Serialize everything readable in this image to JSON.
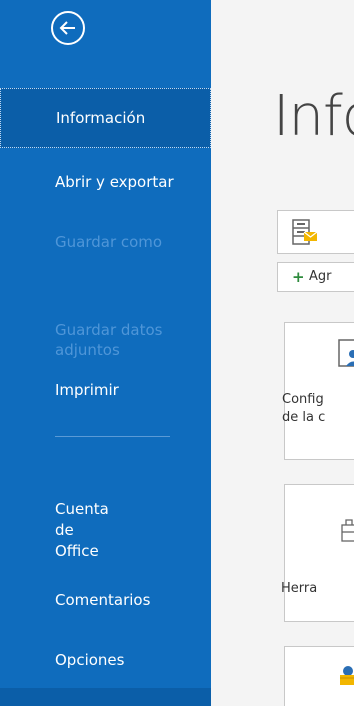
{
  "sidebar": {
    "items": [
      {
        "label": "Información"
      },
      {
        "label": "Abrir y exportar"
      },
      {
        "label": "Guardar como"
      },
      {
        "label": "Guardar datos\nadjuntos"
      },
      {
        "label": "Imprimir"
      },
      {
        "label": "Cuenta\nde\nOffice"
      },
      {
        "label": "Comentarios"
      },
      {
        "label": "Opciones"
      }
    ]
  },
  "main": {
    "title": "Info",
    "add_label": "Agr",
    "cards": [
      {
        "label": "Config\nde la c",
        "icon": "account-settings-icon"
      },
      {
        "label": "Herra",
        "icon": "tools-icon"
      }
    ]
  },
  "colors": {
    "sidebar": "#0f6cbd",
    "selected": "#0b5ea8",
    "disabled_text": "#4f96d8"
  }
}
